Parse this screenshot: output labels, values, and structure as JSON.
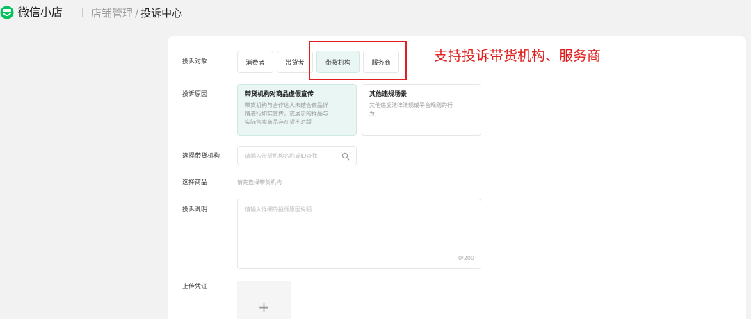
{
  "header": {
    "app_name": "微信小店",
    "breadcrumb_parent": "店铺管理",
    "breadcrumb_separator": "/",
    "breadcrumb_current": "投诉中心",
    "logo_icon": "wechat-store-logo-icon",
    "brand_color": "#07c160"
  },
  "form": {
    "target": {
      "label": "投诉对象",
      "options": [
        "消费者",
        "带货者",
        "带货机构",
        "服务商"
      ],
      "selected": "带货机构"
    },
    "reason": {
      "label": "投诉原因",
      "options": [
        {
          "title": "带货机构对商品虚假宣传",
          "desc_lines": [
            "带货机构与合作达人未结合商品详",
            "情进行如实宣传，或展示的样品与",
            "实际售卖商品存在货不对版"
          ]
        },
        {
          "title": "其他违规场景",
          "desc_lines": [
            "其他违反法律法规或平台规则的行",
            "为"
          ]
        }
      ],
      "selected": "带货机构对商品虚假宣传"
    },
    "institution": {
      "label": "选择带货机构",
      "placeholder": "请输入带货机构名称或ID查找",
      "icon": "search-icon"
    },
    "product": {
      "label": "选择商品",
      "hint": "请先选择带货机构"
    },
    "description": {
      "label": "投诉说明",
      "placeholder": "请输入详细的投诉原因说明",
      "counter": "0/200"
    },
    "evidence": {
      "label": "上传凭证",
      "plus": "+"
    }
  },
  "annotation": {
    "text": "支持投诉带货机构、服务商",
    "color": "#e02020"
  },
  "colors": {
    "selected_bg": "#e9f6f3",
    "page_bg": "#f2f2f2"
  }
}
